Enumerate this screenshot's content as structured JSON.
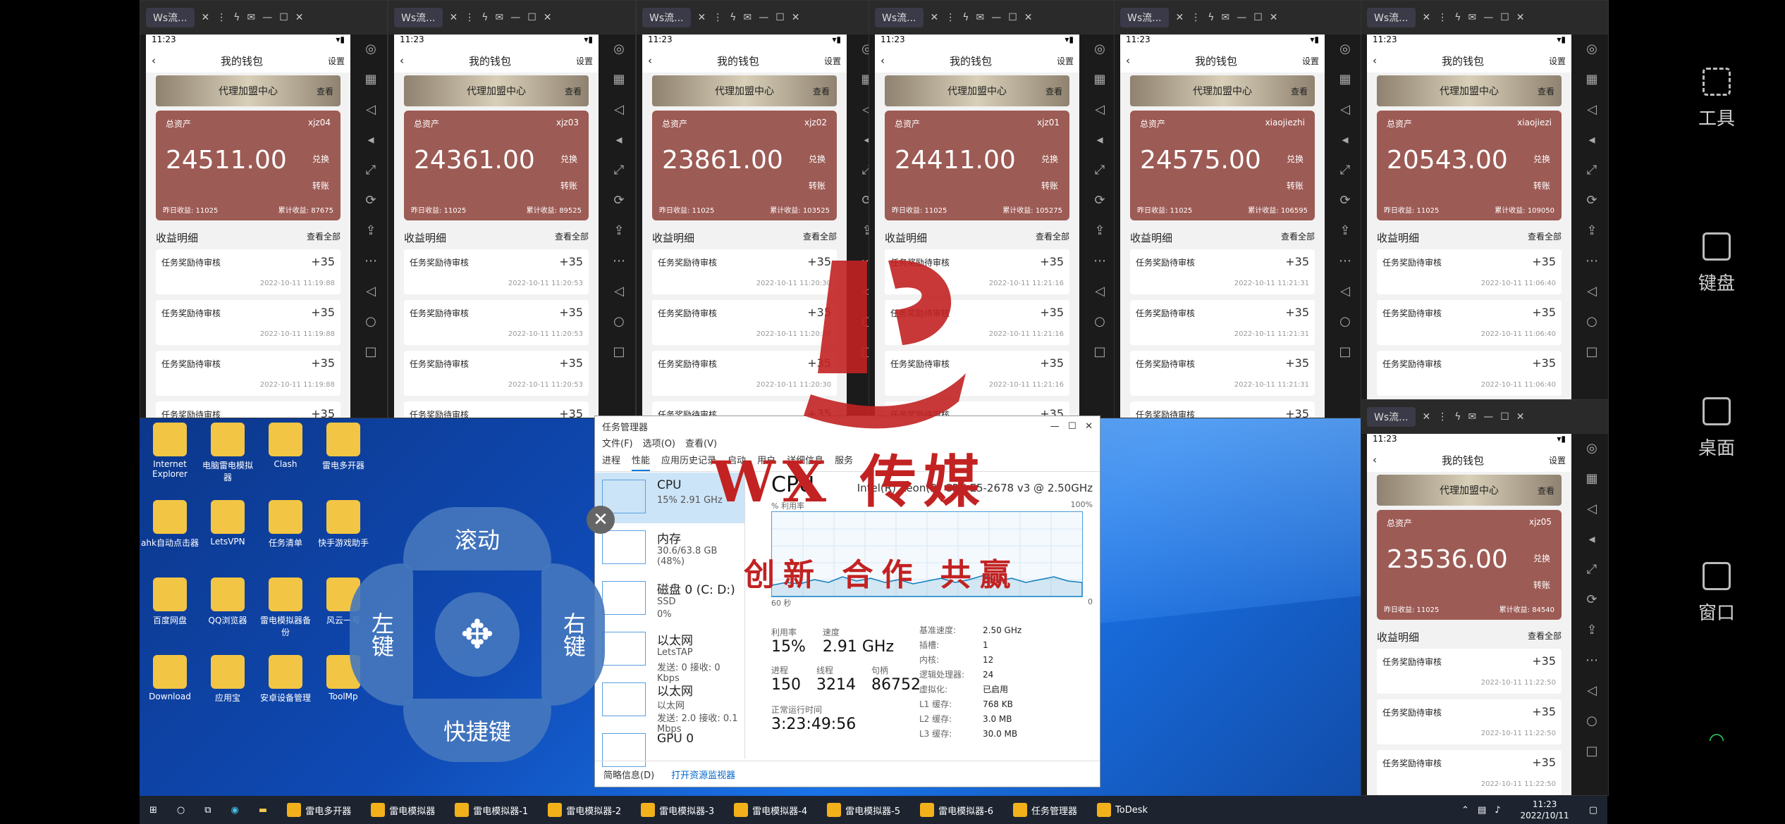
{
  "phones": [
    {
      "tab": "Ws流...",
      "title": "我的钱包",
      "settings": "设置",
      "banner": "代理加盟中心",
      "view": "查看",
      "total_label": "总资产",
      "uid": "xjz04",
      "amount": "24511.00",
      "exchange": "兑换",
      "transfer": "转账",
      "yesterday": "昨日收益: 11025",
      "cumulative": "累计收益: 87675",
      "section": "收益明细",
      "see_all": "查看全部",
      "item_title": "任务奖励待审核",
      "plus": "+35",
      "date": "2022-10-11 11:19:88"
    },
    {
      "tab": "Ws流...",
      "title": "我的钱包",
      "settings": "设置",
      "banner": "代理加盟中心",
      "view": "查看",
      "total_label": "总资产",
      "uid": "xjz03",
      "amount": "24361.00",
      "exchange": "兑换",
      "transfer": "转账",
      "yesterday": "昨日收益: 11025",
      "cumulative": "累计收益: 89525",
      "section": "收益明细",
      "see_all": "查看全部",
      "item_title": "任务奖励待审核",
      "plus": "+35",
      "date": "2022-10-11 11:20:53"
    },
    {
      "tab": "Ws流...",
      "title": "我的钱包",
      "settings": "设置",
      "banner": "代理加盟中心",
      "view": "查看",
      "total_label": "总资产",
      "uid": "xjz02",
      "amount": "23861.00",
      "exchange": "兑换",
      "transfer": "转账",
      "yesterday": "昨日收益: 11025",
      "cumulative": "累计收益: 103525",
      "section": "收益明细",
      "see_all": "查看全部",
      "item_title": "任务奖励待审核",
      "plus": "+35",
      "date": "2022-10-11 11:20:30"
    },
    {
      "tab": "Ws流...",
      "title": "我的钱包",
      "settings": "设置",
      "banner": "代理加盟中心",
      "view": "查看",
      "total_label": "总资产",
      "uid": "xjz01",
      "amount": "24411.00",
      "exchange": "兑换",
      "transfer": "转账",
      "yesterday": "昨日收益: 11025",
      "cumulative": "累计收益: 105275",
      "section": "收益明细",
      "see_all": "查看全部",
      "item_title": "任务奖励待审核",
      "plus": "+35",
      "date": "2022-10-11 11:21:16"
    },
    {
      "tab": "Ws流...",
      "title": "我的钱包",
      "settings": "设置",
      "banner": "代理加盟中心",
      "view": "查看",
      "total_label": "总资产",
      "uid": "xiaojiezhi",
      "amount": "24575.00",
      "exchange": "兑换",
      "transfer": "转账",
      "yesterday": "昨日收益: 11025",
      "cumulative": "累计收益: 106595",
      "section": "收益明细",
      "see_all": "查看全部",
      "item_title": "任务奖励待审核",
      "plus": "+35",
      "date": "2022-10-11 11:21:31"
    },
    {
      "tab": "Ws流...",
      "title": "我的钱包",
      "settings": "设置",
      "banner": "代理加盟中心",
      "view": "查看",
      "total_label": "总资产",
      "uid": "xiaojiezi",
      "amount": "20543.00",
      "exchange": "兑换",
      "transfer": "转账",
      "yesterday": "昨日收益: 11025",
      "cumulative": "累计收益: 109050",
      "section": "收益明细",
      "see_all": "查看全部",
      "item_title": "任务奖励待审核",
      "plus": "+35",
      "date": "2022-10-11 11:06:40"
    },
    {
      "tab": "Ws流...",
      "title": "我的钱包",
      "settings": "设置",
      "banner": "代理加盟中心",
      "view": "查看",
      "total_label": "总资产",
      "uid": "xjz05",
      "amount": "23536.00",
      "exchange": "兑换",
      "transfer": "转账",
      "yesterday": "昨日收益: 11025",
      "cumulative": "累计收益: 84540",
      "section": "收益明细",
      "see_all": "查看全部",
      "item_title": "任务奖励待审核",
      "plus": "+35",
      "date": "2022-10-11 11:22:50"
    }
  ],
  "status_time": "11:23",
  "desktop_icons": [
    "Internet Explorer",
    "电脑雷电模拟器",
    "Clash",
    "雷电多开器",
    "ahk自动点击器",
    "LetsVPN",
    "任务清单",
    "快手游戏助手",
    "百度网盘",
    "QQ浏览器",
    "雷电模拟器备份",
    "风云一号",
    "Download",
    "应用宝",
    "安卓设备管理",
    "ToolMp"
  ],
  "joystick": {
    "up": "滚动",
    "left": "左键",
    "right": "右键",
    "down": "快捷键"
  },
  "taskmgr": {
    "title": "任务管理器",
    "menu": [
      "文件(F)",
      "选项(O)",
      "查看(V)"
    ],
    "tabs": [
      "进程",
      "性能",
      "应用历史记录",
      "启动",
      "用户",
      "详细信息",
      "服务"
    ],
    "left": [
      {
        "name": "CPU",
        "d1": "15% 2.91 GHz",
        "d2": ""
      },
      {
        "name": "内存",
        "d1": "30.6/63.8 GB (48%)",
        "d2": ""
      },
      {
        "name": "磁盘 0 (C: D:)",
        "d1": "SSD",
        "d2": "0%"
      },
      {
        "name": "以太网",
        "d1": "LetsTAP",
        "d2": "发送: 0 接收: 0 Kbps"
      },
      {
        "name": "以太网",
        "d1": "以太网",
        "d2": "发送: 2.0 接收: 0.1 Mbps"
      },
      {
        "name": "GPU 0",
        "d1": "",
        "d2": ""
      }
    ],
    "cpu_title": "CPU",
    "cpu_model": "Intel(R) Xeon(R) CPU E5-2678 v3 @ 2.50GHz",
    "usage_label": "% 利用率",
    "hundred": "100%",
    "sixty": "60 秒",
    "zero": "0",
    "util_label": "利用率",
    "util": "15%",
    "speed_label": "速度",
    "speed": "2.91 GHz",
    "proc_label": "进程",
    "proc": "150",
    "threads_label": "线程",
    "threads": "3214",
    "handles_label": "句柄",
    "handles": "86752",
    "uptime_label": "正常运行时间",
    "uptime": "3:23:49:56",
    "spec_keys": [
      "基准速度:",
      "插槽:",
      "内核:",
      "逻辑处理器:",
      "虚拟化:",
      "L1 缓存:",
      "L2 缓存:",
      "L3 缓存:"
    ],
    "spec_vals": [
      "2.50 GHz",
      "1",
      "12",
      "24",
      "已启用",
      "768 KB",
      "3.0 MB",
      "30.0 MB"
    ],
    "brief": "简略信息(D)",
    "open_monitor": "打开资源监视器"
  },
  "taskbar": {
    "items": [
      "雷电多开器",
      "雷电模拟器",
      "雷电模拟器-1",
      "雷电模拟器-2",
      "雷电模拟器-3",
      "雷电模拟器-4",
      "雷电模拟器-5",
      "雷电模拟器-6",
      "任务管理器",
      "ToDesk"
    ],
    "time": "11:23",
    "date": "2022/10/11"
  },
  "right_panel": [
    "工具",
    "键盘",
    "桌面",
    "窗口"
  ],
  "watermark": {
    "main": "WX 传媒",
    "sub": "创新 合作 共赢"
  }
}
